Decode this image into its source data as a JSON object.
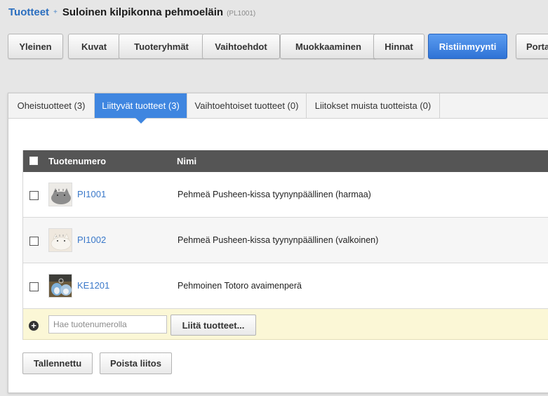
{
  "breadcrumb": {
    "parent": "Tuotteet",
    "separator": "+",
    "title": "Suloinen kilpikonna pehmoeläin",
    "code": "(PL1001)"
  },
  "main_tabs": [
    {
      "label": "Yleinen",
      "active": false
    },
    {
      "label": "Kuvat",
      "active": false
    },
    {
      "label": "Tuoteryhmät",
      "active": false
    },
    {
      "label": "Vaihtoehdot",
      "active": false
    },
    {
      "label": "Muokkaaminen",
      "active": false
    },
    {
      "label": "Hinnat",
      "active": false
    },
    {
      "label": "Ristiinmyynti",
      "active": true
    },
    {
      "label": "Porta",
      "active": false
    }
  ],
  "sub_tabs": [
    {
      "label": "Oheistuotteet (3)",
      "active": false
    },
    {
      "label": "Liittyvät tuotteet (3)",
      "active": true
    },
    {
      "label": "Vaihtoehtoiset tuotteet (0)",
      "active": false
    },
    {
      "label": "Liitokset muista tuotteista (0)",
      "active": false
    }
  ],
  "table": {
    "headers": {
      "number": "Tuotenumero",
      "name": "Nimi"
    },
    "rows": [
      {
        "number": "PI1001",
        "name": "Pehmeä Pusheen-kissa tyynynpäällinen (harmaa)",
        "thumb_icon": "grey-cat-cushion-thumbnail"
      },
      {
        "number": "PI1002",
        "name": "Pehmeä Pusheen-kissa tyynynpäällinen (valkoinen)",
        "thumb_icon": "white-cat-cushion-thumbnail"
      },
      {
        "number": "KE1201",
        "name": "Pehmoinen Totoro avaimenperä",
        "thumb_icon": "totoro-keychain-thumbnail"
      }
    ]
  },
  "add_row": {
    "search_placeholder": "Hae tuotenumerolla",
    "search_value": "",
    "link_button": "Liitä tuotteet..."
  },
  "footer": {
    "save_button": "Tallennettu",
    "remove_button": "Poista liitos"
  },
  "colors": {
    "accent": "#3f86e0",
    "link": "#3a78c9",
    "header_bg": "#555555",
    "add_row_bg": "#fbf7d6"
  }
}
